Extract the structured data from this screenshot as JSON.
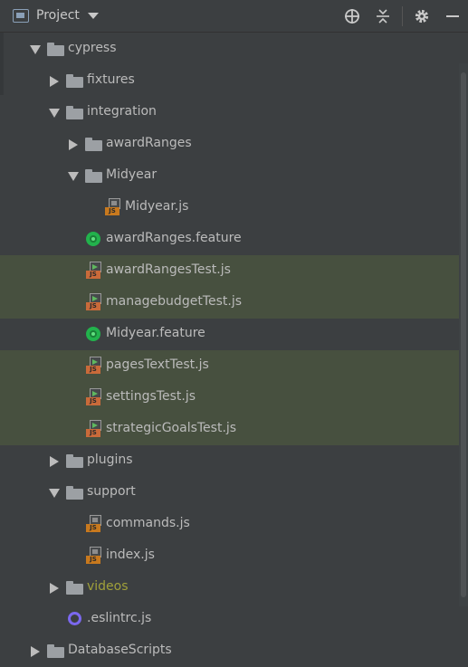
{
  "header": {
    "title": "Project",
    "icons": [
      "window-icon",
      "caret-down-icon",
      "crosshair-icon",
      "collapse-icon",
      "gear-icon",
      "minimize-icon"
    ]
  },
  "tree": {
    "cypress": "cypress",
    "fixtures": "fixtures",
    "integration": "integration",
    "awardRanges": "awardRanges",
    "Midyear": "Midyear",
    "Midyear_js": "Midyear.js",
    "awardRanges_feature": "awardRanges.feature",
    "awardRangesTest": "awardRangesTest.js",
    "managebudgetTest": "managebudgetTest.js",
    "Midyear_feature": "Midyear.feature",
    "pagesTextTest": "pagesTextTest.js",
    "settingsTest": "settingsTest.js",
    "strategicGoalsTest": "strategicGoalsTest.js",
    "plugins": "plugins",
    "support": "support",
    "commands": "commands.js",
    "index": "index.js",
    "videos": "videos",
    "eslintrc": ".eslintrc.js",
    "DatabaseScripts": "DatabaseScripts"
  },
  "colors": {
    "background": "#3c3f41",
    "highlight": "#47503f",
    "text": "#bbbbbb",
    "ignored_folder_text": "#a0a03a",
    "js_badge": "#c8791e",
    "cucumber": "#22b24c",
    "eslint": "#7b68ee"
  }
}
